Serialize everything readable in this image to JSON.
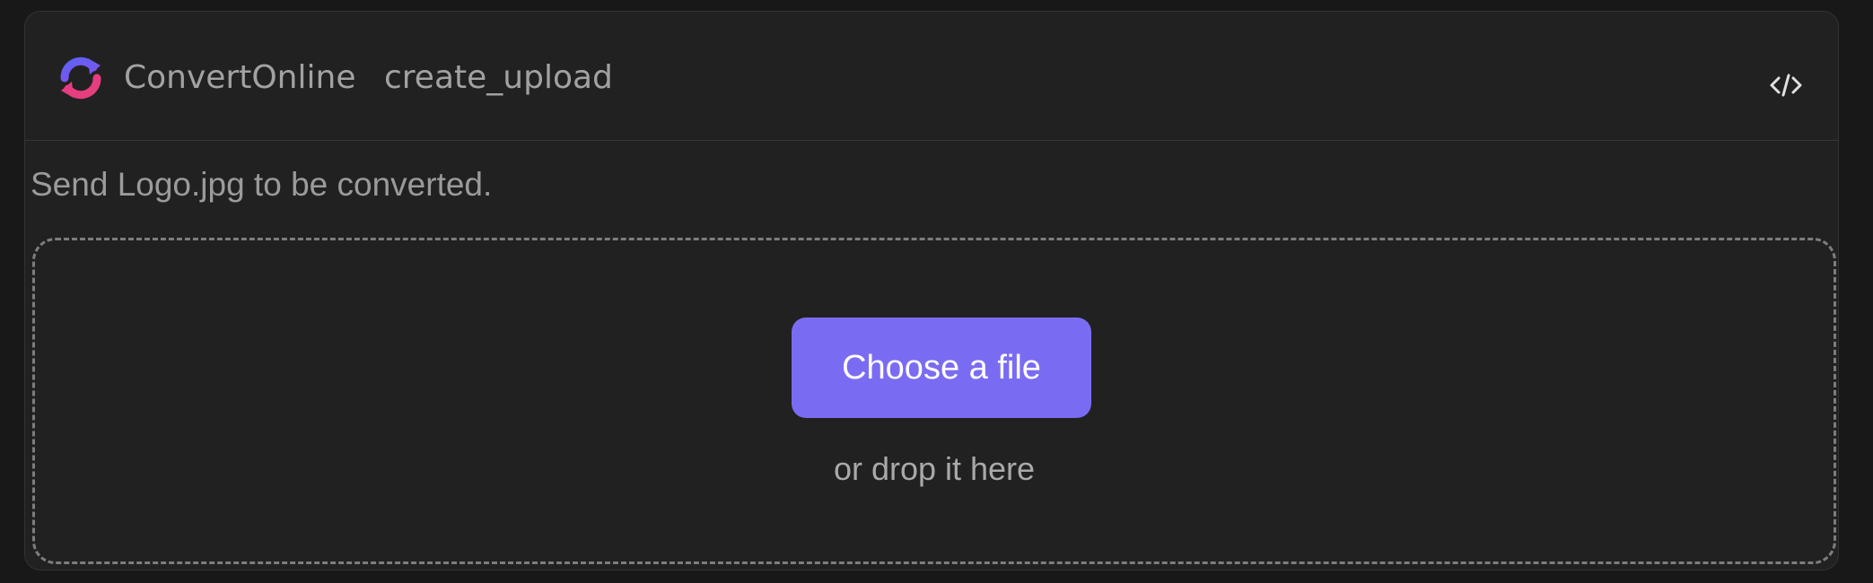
{
  "header": {
    "app_name": "ConvertOnline",
    "tool_name": "create_upload",
    "logo_icon": "convert-refresh-icon",
    "code_toggle_icon": "code-brackets-icon"
  },
  "description": "Send Logo.jpg to be converted.",
  "upload": {
    "button_label": "Choose a file",
    "drop_hint": "or drop it here"
  },
  "colors": {
    "background": "#181818",
    "card": "#212121",
    "accent": "#7a6cf2",
    "text_muted": "#a2a2a2",
    "dashed_border": "#7d7d7d"
  }
}
